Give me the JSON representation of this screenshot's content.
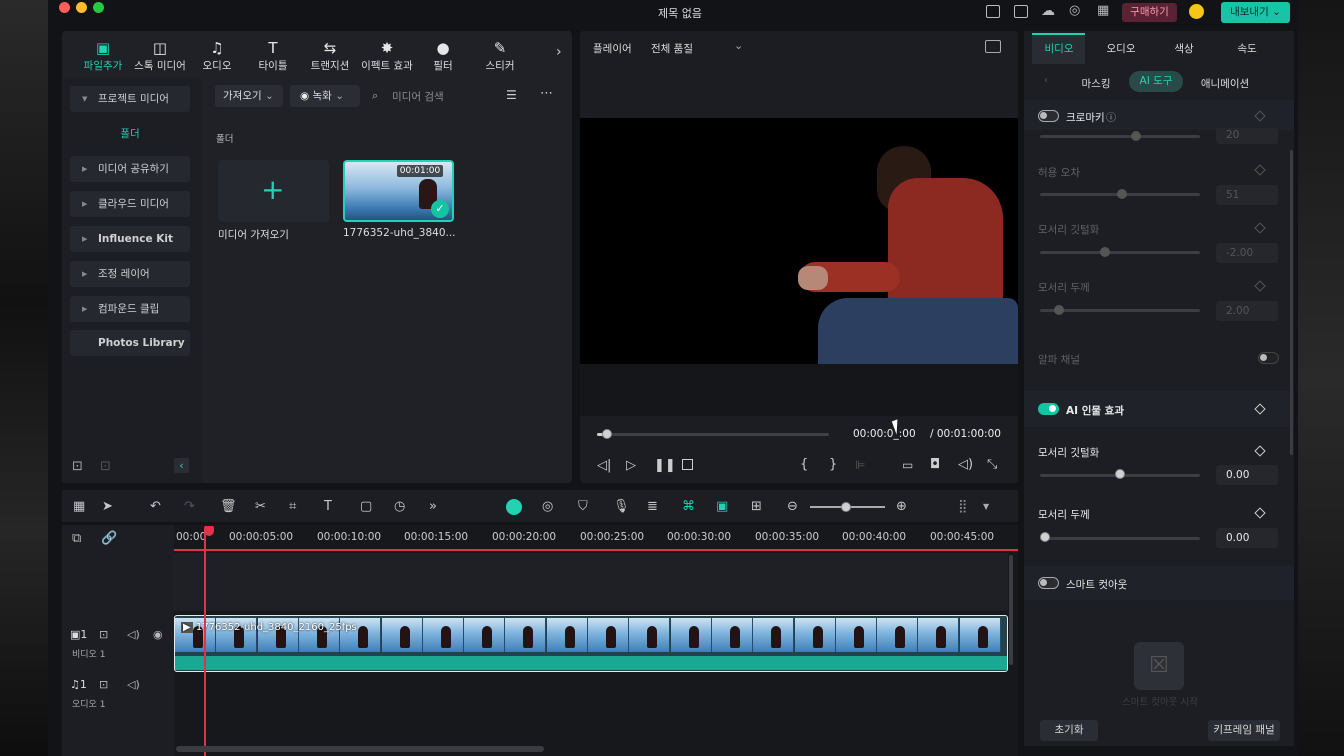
{
  "window": {
    "title": "제목 없음",
    "buy_label": "구매하기",
    "export_label": "내보내기"
  },
  "media_tabs": [
    {
      "label": "파일추가",
      "icon": "import-media-icon",
      "active": true
    },
    {
      "label": "스톡 미디어",
      "icon": "stock-media-icon"
    },
    {
      "label": "오디오",
      "icon": "music-note-icon"
    },
    {
      "label": "타이틀",
      "icon": "title-text-icon"
    },
    {
      "label": "트랜지션",
      "icon": "transition-icon"
    },
    {
      "label": "이펙트 효과",
      "icon": "effects-sparkle-icon"
    },
    {
      "label": "필터",
      "icon": "filter-icon"
    },
    {
      "label": "스티커",
      "icon": "sticker-icon"
    }
  ],
  "left_nav": {
    "project_media": "프로젝트 미디어",
    "folder": "폴더",
    "items": [
      "미디어 공유하기",
      "클라우드 미디어",
      "Influence Kit",
      "조정 레이어",
      "컴파운드 클립"
    ],
    "photos_library": "Photos Library"
  },
  "media_toolbar": {
    "import": "가져오기",
    "record": "녹화",
    "search_placeholder": "미디어 검색"
  },
  "media_grid": {
    "section_label": "폴더",
    "import_tile_label": "미디어 가져오기",
    "clip": {
      "name": "1776352-uhd_3840...",
      "duration": "00:01:00"
    }
  },
  "player": {
    "label": "플레이어",
    "quality": "전체 품질",
    "current_time": "00:00:0_:00",
    "total_time": "/ 00:01:00:00",
    "progress": 0.03
  },
  "timeline": {
    "ruler": [
      "00:00",
      "00:00:05:00",
      "00:00:10:00",
      "00:00:15:00",
      "00:00:20:00",
      "00:00:25:00",
      "00:00:30:00",
      "00:00:35:00",
      "00:00:40:00",
      "00:00:45:00"
    ],
    "video_track": {
      "index": "1",
      "label": "비디오 1",
      "clip_name": "1776352-uhd_3840_2160_25fps"
    },
    "audio_track": {
      "index": "1",
      "label": "오디오 1"
    }
  },
  "right_panel": {
    "tabs": [
      "비디오",
      "오디오",
      "색상",
      "속도"
    ],
    "subtabs": [
      "마스킹",
      "AI 도구",
      "애니메이션"
    ],
    "chroma_key": {
      "label": "크로마키",
      "enabled": false
    },
    "tolerance_value": "20",
    "tolerance_error": {
      "label": "허용 오차",
      "value": "51"
    },
    "edge_feather_dim": {
      "label": "모서리 깃털화",
      "value": "-2.00"
    },
    "edge_thickness_dim": {
      "label": "모서리 두께",
      "value": "2.00"
    },
    "alpha_channel": {
      "label": "알파 채널"
    },
    "ai_portrait": {
      "label": "AI 인물 효과",
      "enabled": true
    },
    "edge_feather": {
      "label": "모서리 깃털화",
      "value": "0.00"
    },
    "edge_thickness": {
      "label": "모서리 두께",
      "value": "0.00"
    },
    "smart_cutout": {
      "label": "스마트 컷아웃",
      "enabled": false,
      "hint": "스마트 컷아웃 시작"
    },
    "reset_label": "초기화",
    "keyframe_label": "키프레임 패널"
  },
  "colors": {
    "accent": "#1fd3b3",
    "playhead": "#e0334a",
    "background": "#121317"
  }
}
